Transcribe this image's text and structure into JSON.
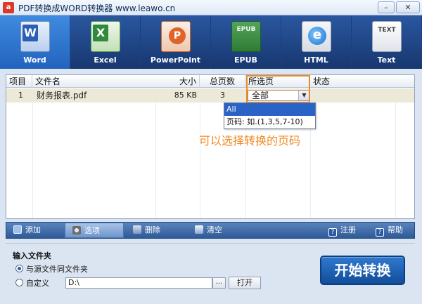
{
  "window": {
    "icon_letter": "a",
    "title": "PDF转换成WORD转换器 www.leawo.cn",
    "minimize": "–",
    "close": "✕"
  },
  "toolbar": {
    "items": [
      {
        "label": "Word",
        "icon": "word-icon",
        "active": true
      },
      {
        "label": "Excel",
        "icon": "excel-icon",
        "active": false
      },
      {
        "label": "PowerPoint",
        "icon": "powerpoint-icon",
        "active": false
      },
      {
        "label": "EPUB",
        "icon": "epub-icon",
        "active": false
      },
      {
        "label": "HTML",
        "icon": "html-icon",
        "active": false
      },
      {
        "label": "Text",
        "icon": "text-icon",
        "active": false
      }
    ]
  },
  "table": {
    "columns": [
      "项目",
      "文件名",
      "大小",
      "总页数",
      "所选页",
      "状态"
    ],
    "rows": [
      {
        "item": "1",
        "filename": "财务报表.pdf",
        "size": "85  KB",
        "pages": "3",
        "selected_pages": "全部",
        "status": ""
      }
    ]
  },
  "page_dropdown": {
    "options": [
      "All",
      "页码: 如.(1,3,5,7-10)"
    ],
    "selected_index": 0
  },
  "annotation": "可以选择转换的页码",
  "bottom_toolbar": {
    "add": "添加",
    "options": "选项",
    "delete": "删除",
    "clear": "清空",
    "register": "注册",
    "help": "帮助"
  },
  "input_folder": {
    "title": "输入文件夹",
    "same_as_source": "与源文件同文件夹",
    "custom": "自定义",
    "path_value": "D:\\",
    "browse": "...",
    "open": "打开"
  },
  "start_button": "开始转换",
  "colors": {
    "accent_orange": "#f08a24",
    "toolbar_blue": "#17376f",
    "selection_blue": "#2a63c6"
  }
}
